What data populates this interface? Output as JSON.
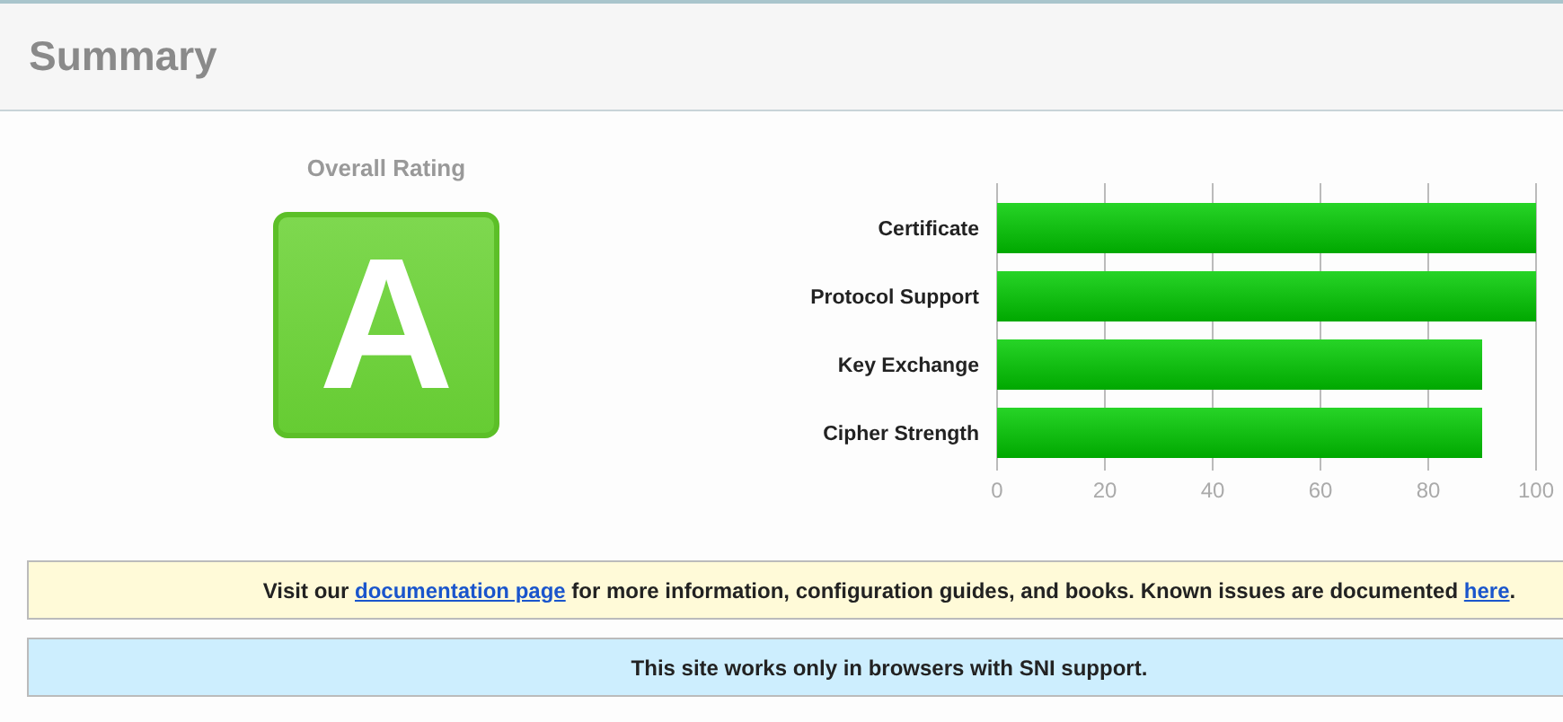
{
  "header": {
    "title": "Summary"
  },
  "rating": {
    "label": "Overall Rating",
    "grade": "A"
  },
  "chart_data": {
    "type": "bar",
    "orientation": "horizontal",
    "categories": [
      "Certificate",
      "Protocol Support",
      "Key Exchange",
      "Cipher Strength"
    ],
    "values": [
      100,
      100,
      90,
      90
    ],
    "xlim": [
      0,
      100
    ],
    "xticks": [
      0,
      20,
      40,
      60,
      80,
      100
    ],
    "grid": true
  },
  "notices": [
    {
      "kind": "warning",
      "segments": [
        {
          "kind": "text",
          "text": "Visit our "
        },
        {
          "kind": "link",
          "text": "documentation page"
        },
        {
          "kind": "text",
          "text": " for more information, configuration guides, and books. Known issues are documented "
        },
        {
          "kind": "link",
          "text": "here"
        },
        {
          "kind": "text",
          "text": "."
        }
      ]
    },
    {
      "kind": "info",
      "segments": [
        {
          "kind": "text",
          "text": "This site works only in browsers with SNI support."
        }
      ]
    }
  ]
}
